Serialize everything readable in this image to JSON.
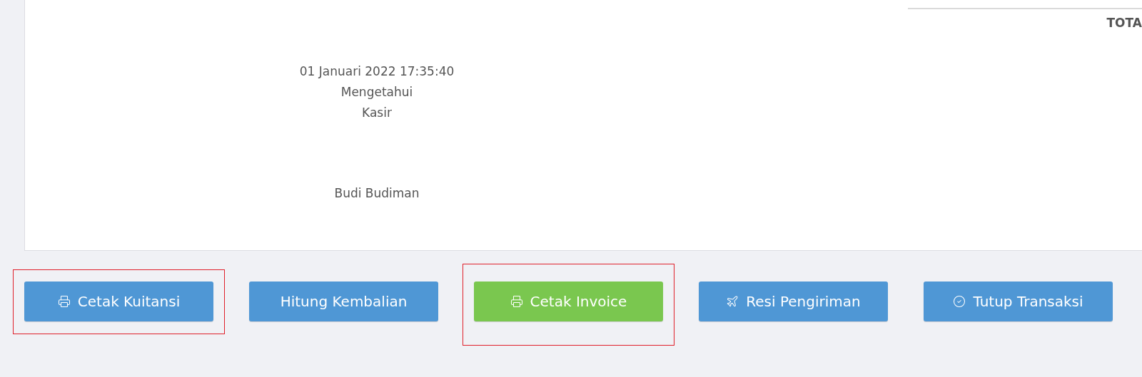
{
  "summary": {
    "total_label": "TOTA"
  },
  "signature": {
    "datetime": "01 Januari 2022 17:35:40",
    "role_title": "Mengetahui",
    "role": "Kasir",
    "name": "Budi Budiman"
  },
  "buttons": [
    {
      "label": "Cetak Kuitansi",
      "kind": "print",
      "color": "#4f97d5",
      "highlighted": true
    },
    {
      "label": "Hitung Kembalian",
      "kind": "plain",
      "color": "#4f97d5",
      "highlighted": false
    },
    {
      "label": "Cetak Invoice",
      "kind": "print",
      "color": "#7ac74f",
      "highlighted": true
    },
    {
      "label": "Resi Pengiriman",
      "kind": "shipping",
      "color": "#4f97d5",
      "highlighted": false
    },
    {
      "label": "Tutup Transaksi",
      "kind": "close",
      "color": "#4f97d5",
      "highlighted": false
    }
  ]
}
